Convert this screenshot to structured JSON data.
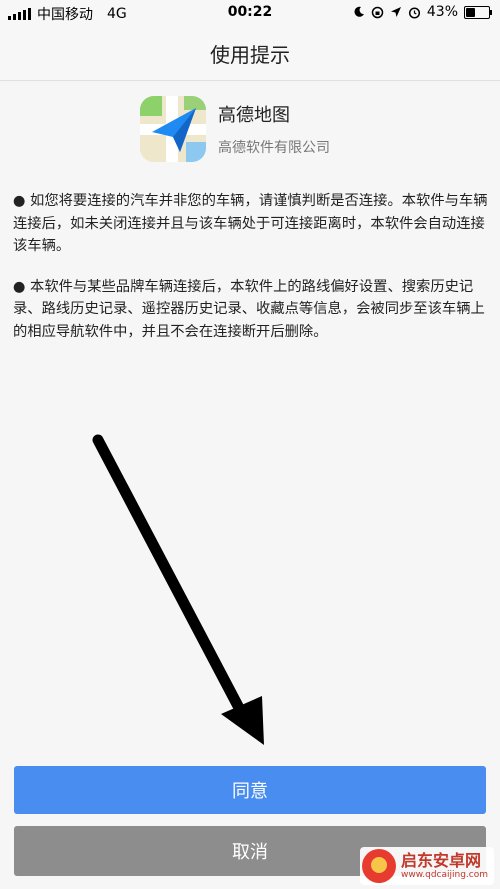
{
  "status_bar": {
    "carrier": "中国移动",
    "network": "4G",
    "time": "00:22",
    "battery": "43%",
    "battery_level": 0.43
  },
  "nav": {
    "title": "使用提示"
  },
  "app": {
    "name": "高德地图",
    "company": "高德软件有限公司"
  },
  "content": {
    "paragraphs": [
      "● 如您将要连接的汽车并非您的车辆，请谨慎判断是否连接。本软件与车辆连接后，如未关闭连接并且与该车辆处于可连接距离时，本软件会自动连接该车辆。",
      "● 本软件与某些品牌车辆连接后，本软件上的路线偏好设置、搜索历史记录、路线历史记录、遥控器历史记录、收藏点等信息，会被同步至该车辆上的相应导航软件中，并且不会在连接断开后删除。"
    ]
  },
  "buttons": {
    "agree": "同意",
    "cancel": "取消"
  },
  "watermark": {
    "name": "启东安卓网",
    "url": "www.qdcaijing.com"
  },
  "colors": {
    "primary": "#4a8df0",
    "cancel": "#8d8d8d",
    "arrow": "#000000"
  }
}
